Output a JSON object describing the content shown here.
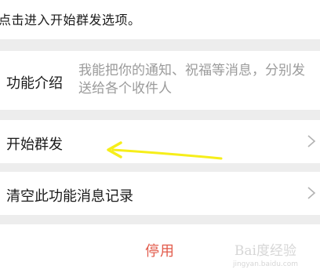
{
  "caption": "点击进入开始群发选项。",
  "intro": {
    "label": "功能介绍",
    "description": "我能把你的通知、祝福等消息，分别发送给各个收件人"
  },
  "rows": [
    {
      "label": "开始群发",
      "icon": "chevron-right-icon"
    },
    {
      "label": "清空此功能消息记录",
      "icon": "chevron-right-icon"
    }
  ],
  "stop_label": "停用",
  "annotation": {
    "arrow_color": "#f6ee1a"
  },
  "watermark": {
    "brand": "Bai度经验",
    "url": "jingyan.baidu.com"
  },
  "colors": {
    "stop": "#e25a4a",
    "secondary_text": "#9b9b9b",
    "background": "#ededed"
  }
}
